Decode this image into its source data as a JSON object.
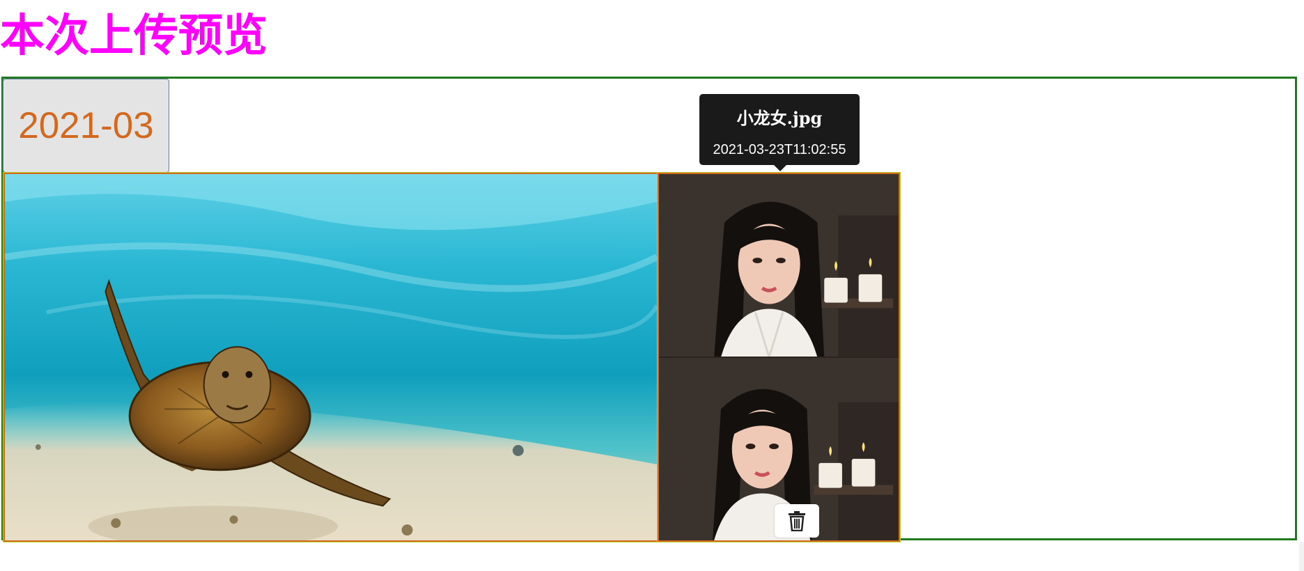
{
  "page": {
    "title": "本次上传预览"
  },
  "gallery": {
    "month_tab": "2021-03",
    "photos": [
      {
        "subject": "sea turtle swimming over sandy sea floor"
      },
      {
        "subject": "two stacked portraits of a woman in white robe with candles"
      }
    ]
  },
  "tooltip": {
    "filename": "小龙女.jpg",
    "timestamp": "2021-03-23T11:02:55"
  },
  "delete_button": {
    "icon": "trash-icon"
  },
  "colors": {
    "title": "#ff00ff",
    "container_border": "#1f7a1f",
    "month_text": "#d2691e",
    "month_bg": "#e4e4e4",
    "photo_border": "#d2691e",
    "tooltip_bg": "#1a1a1a"
  }
}
